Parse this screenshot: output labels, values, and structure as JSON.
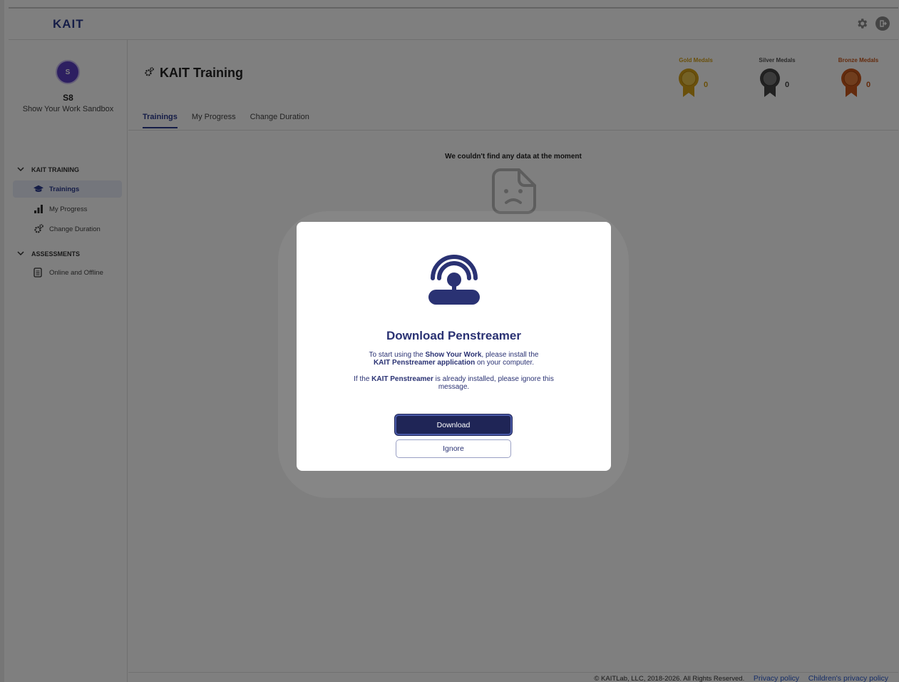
{
  "app": {
    "logo": "KAIT"
  },
  "topbar": {
    "settings_icon": "gear-icon",
    "logout_icon": "logout-icon"
  },
  "user": {
    "avatar_initial": "S",
    "name": "S8",
    "org": "Show Your Work Sandbox"
  },
  "sidebar": {
    "sections": [
      {
        "label": "KAIT TRAINING",
        "items": [
          {
            "label": "Trainings",
            "icon": "graduation-cap-icon",
            "active": true
          },
          {
            "label": "My Progress",
            "icon": "bar-chart-icon",
            "active": false
          },
          {
            "label": "Change Duration",
            "icon": "gears-icon",
            "active": false
          }
        ]
      },
      {
        "label": "ASSESSMENTS",
        "items": [
          {
            "label": "Online and Offline",
            "icon": "document-icon",
            "active": false
          }
        ]
      }
    ]
  },
  "main": {
    "title": "KAIT Training",
    "medals": [
      {
        "label": "Gold Medals",
        "count": "0",
        "color": "#d4a017"
      },
      {
        "label": "Silver Medals",
        "count": "0",
        "color": "#555555"
      },
      {
        "label": "Bronze Medals",
        "count": "0",
        "color": "#c8561a"
      }
    ],
    "tabs": [
      {
        "label": "Trainings",
        "active": true
      },
      {
        "label": "My Progress",
        "active": false
      },
      {
        "label": "Change Duration",
        "active": false
      }
    ],
    "empty_message": "We couldn't find any data at the moment"
  },
  "footer": {
    "copyright": "© KAITLab, LLC, 2018-2026. All Rights Reserved.",
    "privacy": "Privacy policy",
    "children_privacy": "Children's privacy policy"
  },
  "modal": {
    "title": "Download Penstreamer",
    "p1_pre": "To start using the ",
    "p1_b1": "Show Your Work",
    "p1_mid": ", please install the ",
    "p1_b2": "KAIT Penstreamer application",
    "p1_post": " on your computer.",
    "p2_pre": "If the ",
    "p2_b": "KAIT Penstreamer",
    "p2_post": " is already installed, please ignore this message.",
    "download_label": "Download",
    "ignore_label": "Ignore",
    "icon": "penstreamer-signal-icon"
  },
  "colors": {
    "brand": "#2b3a8f",
    "modal_text": "#2a3273",
    "button_dark": "#1f2556"
  }
}
